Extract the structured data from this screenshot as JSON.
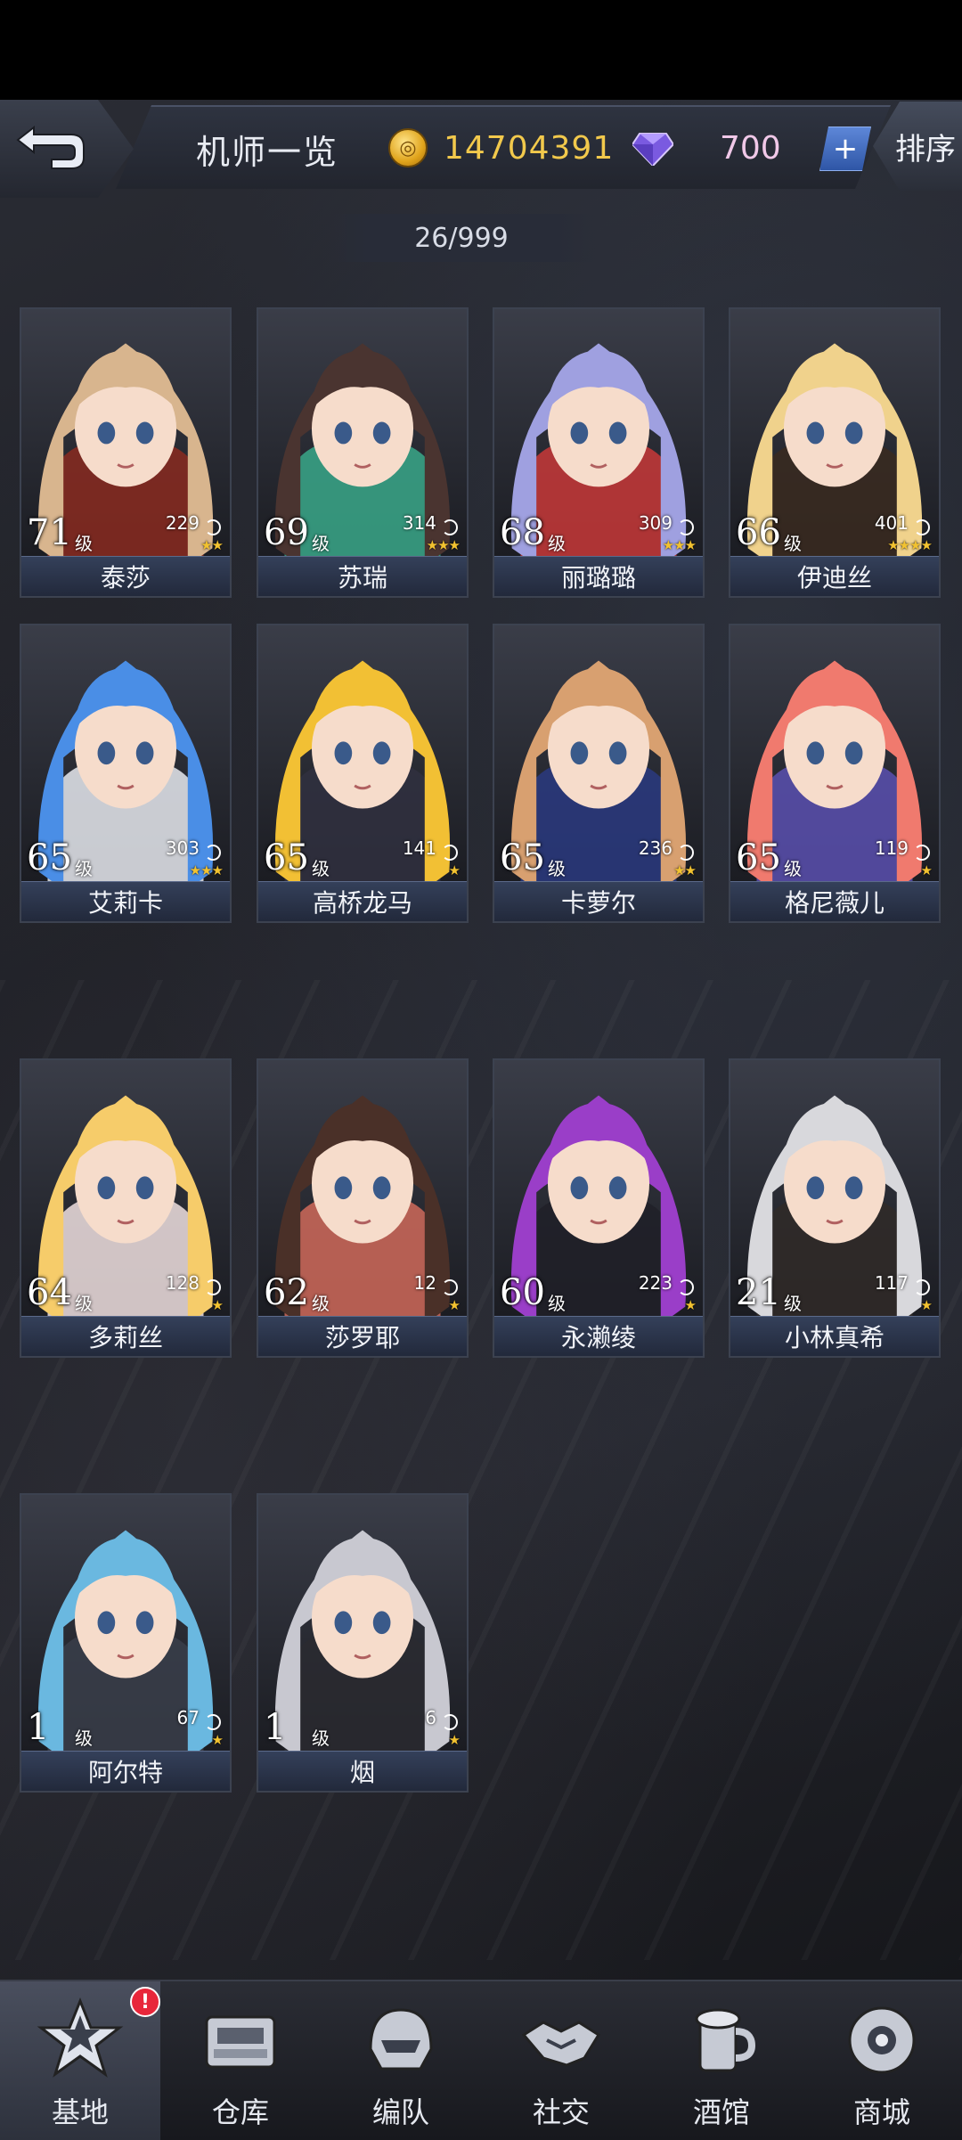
{
  "header": {
    "title": "机师一览",
    "gold": "14704391",
    "gems": "700",
    "plus_label": "+",
    "sort_label": "排序",
    "count": "26/999"
  },
  "pilots": [
    {
      "name": "泰莎",
      "level": "71",
      "level_suffix": "级",
      "power": "229",
      "stars": "★★",
      "hair": "#d8b58e",
      "accent": "#8a2a20"
    },
    {
      "name": "苏瑞",
      "level": "69",
      "level_suffix": "级",
      "power": "314",
      "stars": "★★★",
      "hair": "#4a3430",
      "accent": "#3aa88a"
    },
    {
      "name": "丽璐璐",
      "level": "68",
      "level_suffix": "级",
      "power": "309",
      "stars": "★★★",
      "hair": "#9fa0e0",
      "accent": "#c83838"
    },
    {
      "name": "伊迪丝",
      "level": "66",
      "level_suffix": "级",
      "power": "401",
      "stars": "★★★★",
      "hair": "#f0d28c",
      "accent": "#3a2a20"
    },
    {
      "name": "艾莉卡",
      "level": "65",
      "level_suffix": "级",
      "power": "303",
      "stars": "★★★",
      "hair": "#4a8ee6",
      "accent": "#e8eaf0"
    },
    {
      "name": "高桥龙马",
      "level": "65",
      "level_suffix": "级",
      "power": "141",
      "stars": "★",
      "hair": "#f2c034",
      "accent": "#303040"
    },
    {
      "name": "卡萝尔",
      "level": "65",
      "level_suffix": "级",
      "power": "236",
      "stars": "★★",
      "hair": "#d8a070",
      "accent": "#2a3a80"
    },
    {
      "name": "格尼薇儿",
      "level": "65",
      "level_suffix": "级",
      "power": "119",
      "stars": "★",
      "hair": "#f07a6e",
      "accent": "#5a50b0"
    },
    {
      "name": "多莉丝",
      "level": "64",
      "level_suffix": "级",
      "power": "128",
      "stars": "★",
      "hair": "#f6cc6a",
      "accent": "#f0e0e0"
    },
    {
      "name": "莎罗耶",
      "level": "62",
      "level_suffix": "级",
      "power": "12",
      "stars": "★",
      "hair": "#4a3028",
      "accent": "#d06a5a"
    },
    {
      "name": "永濑绫",
      "level": "60",
      "level_suffix": "级",
      "power": "223",
      "stars": "★",
      "hair": "#9a3ec8",
      "accent": "#202028"
    },
    {
      "name": "小林真希",
      "level": "21",
      "level_suffix": "级",
      "power": "117",
      "stars": "★",
      "hair": "#d8d8dc",
      "accent": "#302a28"
    },
    {
      "name": "阿尔特",
      "level": "1",
      "level_suffix": "级",
      "power": "67",
      "stars": "★",
      "hair": "#6ab8e0",
      "accent": "#3a3e4a"
    },
    {
      "name": "烟",
      "level": "1",
      "level_suffix": "级",
      "power": "6",
      "stars": "★",
      "hair": "#c8c8d0",
      "accent": "#2a2a30"
    }
  ],
  "nav": {
    "items": [
      {
        "label": "基地",
        "icon": "base-emblem-icon"
      },
      {
        "label": "仓库",
        "icon": "warehouse-icon"
      },
      {
        "label": "编队",
        "icon": "helmet-icon"
      },
      {
        "label": "社交",
        "icon": "handshake-icon"
      },
      {
        "label": "酒馆",
        "icon": "tavern-icon"
      },
      {
        "label": "商城",
        "icon": "shop-icon"
      }
    ],
    "alert": "!"
  }
}
